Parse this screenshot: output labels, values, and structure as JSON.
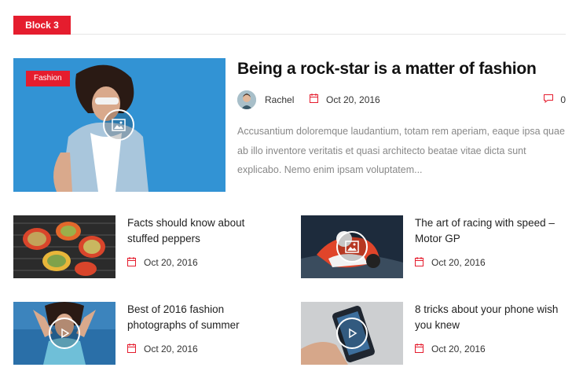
{
  "block": {
    "label": "Block 3"
  },
  "featured": {
    "category": "Fashion",
    "title": "Being a rock-star is a matter of fashion",
    "author": "Rachel",
    "date": "Oct 20, 2016",
    "comments": "0",
    "excerpt": "Accusantium doloremque laudantium, totam rem aperiam, eaque ipsa quae ab illo inventore veritatis et quasi architecto beatae vitae dicta sunt explicabo. Nemo enim ipsam voluptatem..."
  },
  "posts": [
    {
      "title": "Facts should know about stuffed peppers",
      "date": "Oct 20, 2016"
    },
    {
      "title": "The art of racing with speed – Motor GP",
      "date": "Oct 20, 2016",
      "media": "image-icon"
    },
    {
      "title": "Best of 2016 fashion photographs of summer",
      "date": "Oct 20, 2016",
      "media": "play-icon"
    },
    {
      "title": "8 tricks about your phone wish you knew",
      "date": "Oct 20, 2016",
      "media": "play-icon"
    }
  ],
  "colors": {
    "accent": "#e51d2e",
    "excerpt": "#888888"
  }
}
